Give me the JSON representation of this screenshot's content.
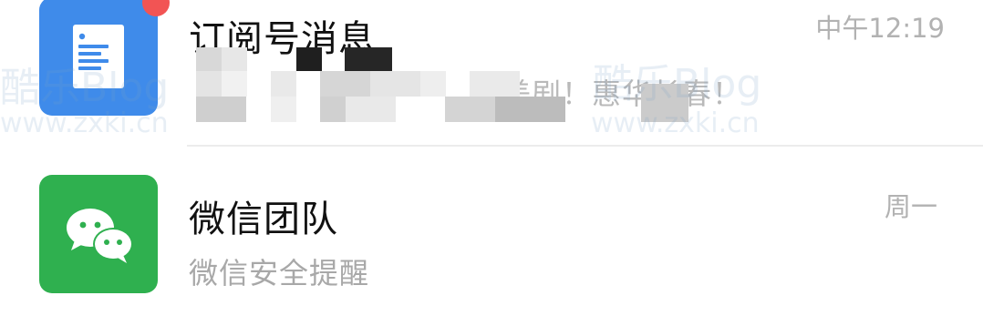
{
  "chats": [
    {
      "name": "订阅号消息",
      "preview": "美剧！惠华长春！",
      "time": "中午12:19",
      "icon": "document-icon",
      "has_badge": true
    },
    {
      "name": "微信团队",
      "preview": "微信安全提醒",
      "time": "周一",
      "icon": "wechat-logo-icon",
      "has_badge": false
    }
  ],
  "watermark": {
    "logo_text": "酷乐Blog",
    "url": "www.zxki.cn"
  },
  "colors": {
    "subscription_avatar": "#3f8bea",
    "wechat_avatar": "#2fb04f",
    "badge": "#f25454",
    "divider": "#ececec"
  }
}
